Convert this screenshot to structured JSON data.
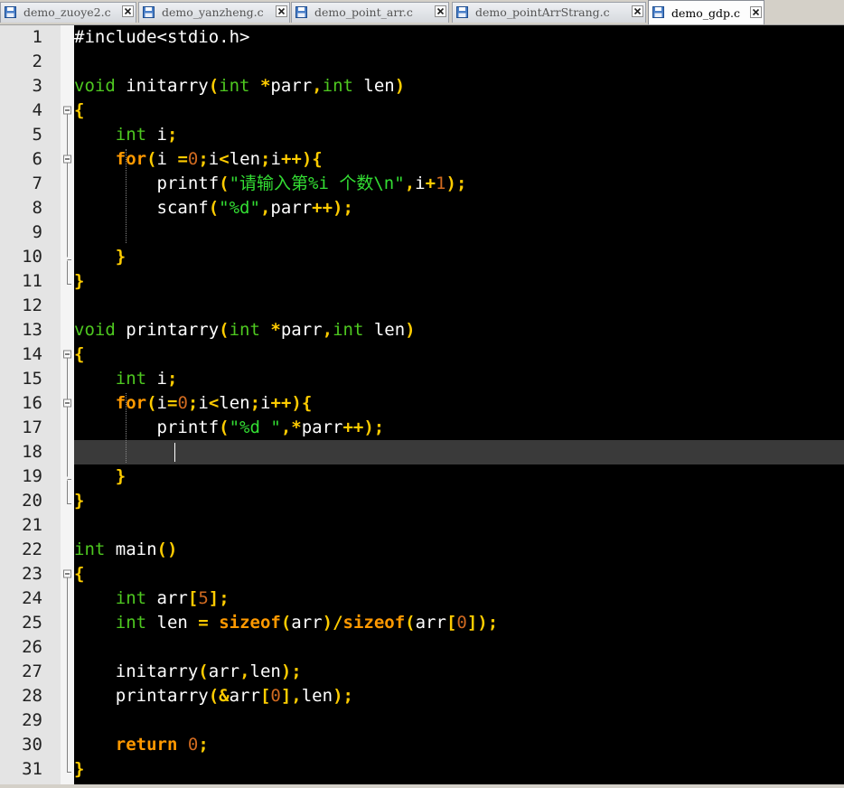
{
  "tabs": [
    {
      "label": "demo_zuoye2.c",
      "active": false
    },
    {
      "label": "demo_yanzheng.c",
      "active": false
    },
    {
      "label": "demo_point_arr.c",
      "active": false
    },
    {
      "label": "demo_pointArrStrang.c",
      "active": false
    },
    {
      "label": "demo_gdp.c",
      "active": true
    }
  ],
  "editor": {
    "current_line": 18,
    "lines": [
      [
        [
          "pp",
          "#include<stdio.h>"
        ]
      ],
      [],
      [
        [
          "k",
          "void"
        ],
        [
          "t",
          " initarry"
        ],
        [
          "op",
          "("
        ],
        [
          "k",
          "int"
        ],
        [
          "t",
          " "
        ],
        [
          "op",
          "*"
        ],
        [
          "t",
          "parr"
        ],
        [
          "op",
          ","
        ],
        [
          "k",
          "int"
        ],
        [
          "t",
          " len"
        ],
        [
          "op",
          ")"
        ]
      ],
      [
        [
          "op",
          "{"
        ]
      ],
      [
        [
          "t",
          "    "
        ],
        [
          "k",
          "int"
        ],
        [
          "t",
          " i"
        ],
        [
          "op",
          ";"
        ]
      ],
      [
        [
          "t",
          "    "
        ],
        [
          "kw",
          "for"
        ],
        [
          "op",
          "("
        ],
        [
          "t",
          "i "
        ],
        [
          "op",
          "="
        ],
        [
          "num",
          "0"
        ],
        [
          "op",
          ";"
        ],
        [
          "t",
          "i"
        ],
        [
          "op",
          "<"
        ],
        [
          "t",
          "len"
        ],
        [
          "op",
          ";"
        ],
        [
          "t",
          "i"
        ],
        [
          "op",
          "++){"
        ]
      ],
      [
        [
          "t",
          "        printf"
        ],
        [
          "op",
          "("
        ],
        [
          "str",
          "\"请输入第%i 个数\\n\""
        ],
        [
          "op",
          ","
        ],
        [
          "t",
          "i"
        ],
        [
          "op",
          "+"
        ],
        [
          "num",
          "1"
        ],
        [
          "op",
          ");"
        ]
      ],
      [
        [
          "t",
          "        scanf"
        ],
        [
          "op",
          "("
        ],
        [
          "str",
          "\"%d\""
        ],
        [
          "op",
          ","
        ],
        [
          "t",
          "parr"
        ],
        [
          "op",
          "++);"
        ]
      ],
      [],
      [
        [
          "t",
          "    "
        ],
        [
          "op",
          "}"
        ]
      ],
      [
        [
          "op",
          "}"
        ]
      ],
      [],
      [
        [
          "k",
          "void"
        ],
        [
          "t",
          " printarry"
        ],
        [
          "op",
          "("
        ],
        [
          "k",
          "int"
        ],
        [
          "t",
          " "
        ],
        [
          "op",
          "*"
        ],
        [
          "t",
          "parr"
        ],
        [
          "op",
          ","
        ],
        [
          "k",
          "int"
        ],
        [
          "t",
          " len"
        ],
        [
          "op",
          ")"
        ]
      ],
      [
        [
          "op",
          "{"
        ]
      ],
      [
        [
          "t",
          "    "
        ],
        [
          "k",
          "int"
        ],
        [
          "t",
          " i"
        ],
        [
          "op",
          ";"
        ]
      ],
      [
        [
          "t",
          "    "
        ],
        [
          "kw",
          "for"
        ],
        [
          "op",
          "("
        ],
        [
          "t",
          "i"
        ],
        [
          "op",
          "="
        ],
        [
          "num",
          "0"
        ],
        [
          "op",
          ";"
        ],
        [
          "t",
          "i"
        ],
        [
          "op",
          "<"
        ],
        [
          "t",
          "len"
        ],
        [
          "op",
          ";"
        ],
        [
          "t",
          "i"
        ],
        [
          "op",
          "++){"
        ]
      ],
      [
        [
          "t",
          "        printf"
        ],
        [
          "op",
          "("
        ],
        [
          "str",
          "\"%d \""
        ],
        [
          "op",
          ","
        ],
        [
          "op",
          "*"
        ],
        [
          "t",
          "parr"
        ],
        [
          "op",
          "++);"
        ]
      ],
      [],
      [
        [
          "t",
          "    "
        ],
        [
          "op",
          "}"
        ]
      ],
      [
        [
          "op",
          "}"
        ]
      ],
      [],
      [
        [
          "k",
          "int"
        ],
        [
          "t",
          " main"
        ],
        [
          "op",
          "()"
        ]
      ],
      [
        [
          "op",
          "{"
        ]
      ],
      [
        [
          "t",
          "    "
        ],
        [
          "k",
          "int"
        ],
        [
          "t",
          " arr"
        ],
        [
          "op",
          "["
        ],
        [
          "num",
          "5"
        ],
        [
          "op",
          "];"
        ]
      ],
      [
        [
          "t",
          "    "
        ],
        [
          "k",
          "int"
        ],
        [
          "t",
          " len "
        ],
        [
          "op",
          "="
        ],
        [
          "t",
          " "
        ],
        [
          "kw",
          "sizeof"
        ],
        [
          "op",
          "("
        ],
        [
          "t",
          "arr"
        ],
        [
          "op",
          ")/"
        ],
        [
          "kw",
          "sizeof"
        ],
        [
          "op",
          "("
        ],
        [
          "t",
          "arr"
        ],
        [
          "op",
          "["
        ],
        [
          "num",
          "0"
        ],
        [
          "op",
          "]);"
        ]
      ],
      [],
      [
        [
          "t",
          "    initarry"
        ],
        [
          "op",
          "("
        ],
        [
          "t",
          "arr"
        ],
        [
          "op",
          ","
        ],
        [
          "t",
          "len"
        ],
        [
          "op",
          ");"
        ]
      ],
      [
        [
          "t",
          "    printarry"
        ],
        [
          "op",
          "(&"
        ],
        [
          "t",
          "arr"
        ],
        [
          "op",
          "["
        ],
        [
          "num",
          "0"
        ],
        [
          "op",
          "],"
        ],
        [
          "t",
          "len"
        ],
        [
          "op",
          ");"
        ]
      ],
      [],
      [
        [
          "t",
          "    "
        ],
        [
          "kw",
          "return"
        ],
        [
          "t",
          " "
        ],
        [
          "num",
          "0"
        ],
        [
          "op",
          ";"
        ]
      ],
      [
        [
          "op",
          "}"
        ]
      ]
    ]
  },
  "colors": {
    "keyword_type": "#4ec820",
    "keyword_flow": "#ff9900",
    "operator": "#ffcc00",
    "string": "#33dd33",
    "number": "#d06a20",
    "background": "#000000",
    "current_line": "#3a3a3a"
  },
  "icons": {
    "tab_file": "floppy-disk-icon",
    "tab_close": "close-icon",
    "fold_open": "fold-minus-icon",
    "fold_end": "fold-end-icon"
  }
}
